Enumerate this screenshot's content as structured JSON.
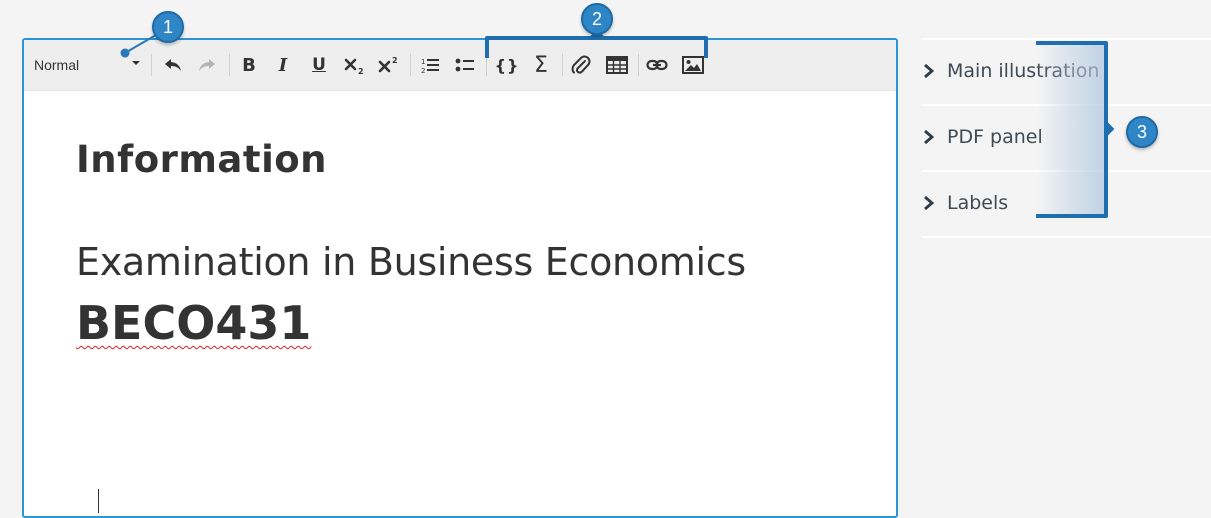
{
  "toolbar": {
    "format_select": {
      "value": "Normal"
    },
    "buttons": [
      {
        "name": "undo-button",
        "icon": "undo-icon"
      },
      {
        "name": "redo-button",
        "icon": "redo-icon"
      },
      {
        "name": "bold-button",
        "icon": "bold-icon",
        "glyph": "B"
      },
      {
        "name": "italic-button",
        "icon": "italic-icon",
        "glyph": "I"
      },
      {
        "name": "underline-button",
        "icon": "underline-icon",
        "glyph": "U"
      },
      {
        "name": "subscript-button",
        "icon": "subscript-icon"
      },
      {
        "name": "superscript-button",
        "icon": "superscript-icon"
      },
      {
        "name": "ordered-list-button",
        "icon": "ordered-list-icon"
      },
      {
        "name": "bullet-list-button",
        "icon": "bullet-list-icon"
      },
      {
        "name": "code-button",
        "icon": "curly-braces-icon",
        "glyph": "{}"
      },
      {
        "name": "formula-button",
        "icon": "sigma-icon",
        "glyph": "Σ"
      },
      {
        "name": "attachment-button",
        "icon": "paperclip-icon"
      },
      {
        "name": "table-button",
        "icon": "table-icon"
      },
      {
        "name": "link-button",
        "icon": "link-icon"
      },
      {
        "name": "image-button",
        "icon": "image-icon"
      }
    ]
  },
  "document": {
    "heading": "Information",
    "subtitle": "Examination in Business Economics",
    "course_code": "BECO431"
  },
  "side_panel": {
    "items": [
      {
        "label": "Main illustration",
        "icon": "chevron-right-icon"
      },
      {
        "label": "PDF panel",
        "icon": "chevron-right-icon"
      },
      {
        "label": "Labels",
        "icon": "chevron-right-icon"
      }
    ]
  },
  "callouts": [
    "1",
    "2",
    "3"
  ],
  "colors": {
    "accent": "#2a96d8",
    "callout": "#2f86c6",
    "toolbar_bg": "#eeeeee",
    "panel_bg": "#f4f4f4",
    "text": "#333333"
  }
}
